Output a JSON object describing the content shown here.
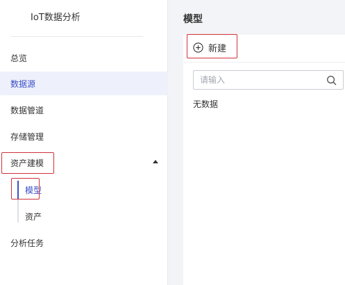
{
  "sidebar": {
    "app_title": "IoT数据分析",
    "items": [
      {
        "label": "总览"
      },
      {
        "label": "数据源"
      },
      {
        "label": "数据管道"
      },
      {
        "label": "存储管理"
      },
      {
        "label": "资产建模"
      },
      {
        "label": "分析任务"
      }
    ],
    "sub_items": [
      {
        "label": "模型"
      },
      {
        "label": "资产"
      }
    ]
  },
  "main": {
    "page_title": "模型",
    "new_button_label": "新建",
    "search": {
      "placeholder": "请输入",
      "value": ""
    },
    "empty_text": "无数据"
  },
  "colors": {
    "accent": "#3a4fc8",
    "highlight_box": "#d0303a",
    "active_bg": "#eef0fb"
  },
  "icons": [
    "plus-circle-icon",
    "search-icon",
    "caret-up-icon"
  ]
}
